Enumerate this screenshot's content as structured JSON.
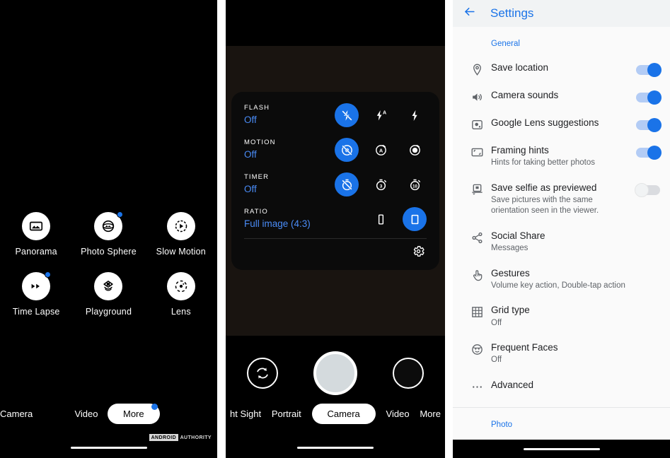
{
  "panel_more": {
    "modes": [
      {
        "label": "Panorama",
        "icon": "panorama-icon",
        "badge": false
      },
      {
        "label": "Photo Sphere",
        "icon": "photo-sphere-icon",
        "badge": true
      },
      {
        "label": "Slow Motion",
        "icon": "slow-motion-icon",
        "badge": false
      },
      {
        "label": "Time Lapse",
        "icon": "time-lapse-icon",
        "badge": true
      },
      {
        "label": "Playground",
        "icon": "playground-icon",
        "badge": false
      },
      {
        "label": "Lens",
        "icon": "lens-icon",
        "badge": false
      }
    ],
    "modebar": [
      {
        "label": "Camera",
        "selected": false,
        "badge": false
      },
      {
        "label": "Video",
        "selected": false,
        "badge": false
      },
      {
        "label": "More",
        "selected": true,
        "badge": true
      }
    ],
    "watermark": {
      "box": "ANDROID",
      "text": "AUTHORITY"
    }
  },
  "panel_viewfinder": {
    "popup": {
      "rows": [
        {
          "caption": "FLASH",
          "value": "Off",
          "options": [
            {
              "icon": "flash-off-icon",
              "selected": true
            },
            {
              "icon": "flash-auto-icon",
              "selected": false
            },
            {
              "icon": "flash-on-icon",
              "selected": false
            }
          ]
        },
        {
          "caption": "MOTION",
          "value": "Off",
          "options": [
            {
              "icon": "motion-off-icon",
              "selected": true
            },
            {
              "icon": "motion-auto-icon",
              "selected": false
            },
            {
              "icon": "motion-on-icon",
              "selected": false
            }
          ]
        },
        {
          "caption": "TIMER",
          "value": "Off",
          "options": [
            {
              "icon": "timer-off-icon",
              "selected": true
            },
            {
              "icon": "timer-3s-icon",
              "selected": false,
              "text": "3"
            },
            {
              "icon": "timer-10s-icon",
              "selected": false,
              "text": "10"
            }
          ]
        },
        {
          "caption": "RATIO",
          "value": "Full image (4:3)",
          "options": [
            {
              "icon": "ratio-16-9-icon",
              "selected": false
            },
            {
              "icon": "ratio-4-3-icon",
              "selected": true
            }
          ]
        }
      ],
      "settings_icon": "gear-icon"
    },
    "controls": {
      "flip_icon": "flip-camera-icon",
      "shutter": "shutter-button",
      "thumbnail": "gallery-thumbnail"
    },
    "modebar": [
      {
        "label": "ht Sight",
        "selected": false
      },
      {
        "label": "Portrait",
        "selected": false
      },
      {
        "label": "Camera",
        "selected": true
      },
      {
        "label": "Video",
        "selected": false
      },
      {
        "label": "More",
        "selected": false
      }
    ]
  },
  "panel_settings": {
    "header": {
      "back_icon": "back-arrow-icon",
      "title": "Settings"
    },
    "section_general": "General",
    "rows": [
      {
        "icon": "location-pin-icon",
        "label": "Save location",
        "sub": "",
        "toggle": "on"
      },
      {
        "icon": "speaker-icon",
        "label": "Camera sounds",
        "sub": "",
        "toggle": "on"
      },
      {
        "icon": "google-lens-icon",
        "label": "Google Lens suggestions",
        "sub": "",
        "toggle": "on"
      },
      {
        "icon": "framing-hints-icon",
        "label": "Framing hints",
        "sub": "Hints for taking better photos",
        "toggle": "on"
      },
      {
        "icon": "save-selfie-icon",
        "label": "Save selfie as previewed",
        "sub": "Save pictures with the same orientation seen in the viewer.",
        "toggle": "off"
      },
      {
        "icon": "share-icon",
        "label": "Social Share",
        "sub": "Messages",
        "toggle": "none"
      },
      {
        "icon": "gestures-icon",
        "label": "Gestures",
        "sub": "Volume key action, Double-tap action",
        "toggle": "none"
      },
      {
        "icon": "grid-icon",
        "label": "Grid type",
        "sub": "Off",
        "toggle": "none"
      },
      {
        "icon": "face-icon",
        "label": "Frequent Faces",
        "sub": "Off",
        "toggle": "none"
      },
      {
        "icon": "more-dots-icon",
        "label": "Advanced",
        "sub": "",
        "toggle": "none"
      }
    ],
    "section_photo": "Photo"
  },
  "colors": {
    "accent_blue": "#1a73e8",
    "popup_blue": "#4a8cf7",
    "panel_bg": "#fafafa",
    "header_bg": "#f1f3f4",
    "viewfinder": "#191410"
  }
}
